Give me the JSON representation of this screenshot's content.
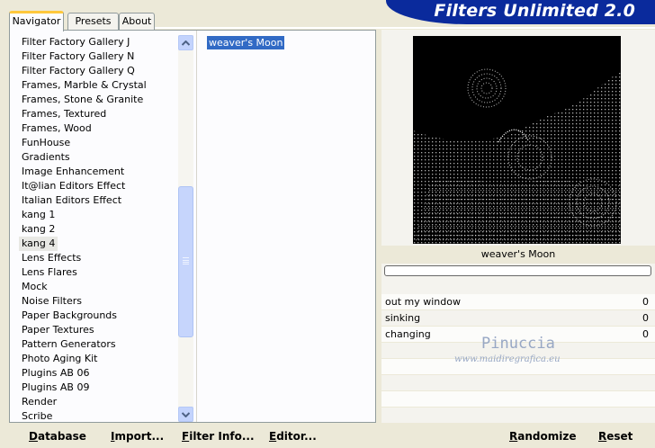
{
  "tabs": [
    {
      "label": "Navigator",
      "active": true
    },
    {
      "label": "Presets",
      "active": false
    },
    {
      "label": "About",
      "active": false
    }
  ],
  "title": "Filters Unlimited 2.0",
  "categories": [
    "Filter Factory Gallery J",
    "Filter Factory Gallery N",
    "Filter Factory Gallery Q",
    "Frames, Marble & Crystal",
    "Frames, Stone & Granite",
    "Frames, Textured",
    "Frames, Wood",
    "FunHouse",
    "Gradients",
    "Image Enhancement",
    "It@lian Editors Effect",
    "Italian Editors Effect",
    "kang 1",
    "kang 2",
    "kang 4",
    "Lens Effects",
    "Lens Flares",
    "Mock",
    "Noise Filters",
    "Paper Backgrounds",
    "Paper Textures",
    "Pattern Generators",
    "Photo Aging Kit",
    "Plugins AB 06",
    "Plugins AB 09",
    "Render",
    "Scribe"
  ],
  "selected_category": "kang 4",
  "filters": [
    "weaver's Moon"
  ],
  "selected_filter": "weaver's Moon",
  "preview": {
    "caption": "weaver's Moon",
    "progress": 0
  },
  "params": [
    {
      "label": "out my window",
      "value": "0"
    },
    {
      "label": "sinking",
      "value": "0"
    },
    {
      "label": "changing",
      "value": "0"
    }
  ],
  "empty_param_rows": 5,
  "watermark": {
    "name": "Pinuccia",
    "url": "www.maidiregrafica.eu"
  },
  "buttons": {
    "database": "Database",
    "import": "Import...",
    "filter_info": "Filter Info...",
    "editor": "Editor...",
    "randomize": "Randomize",
    "reset": "Reset"
  },
  "colors": {
    "title_bar": "#0a2a9c",
    "selection": "#316ac5",
    "tab_highlight": "#ffc83c",
    "scrollbar": "#c6d5fc"
  }
}
